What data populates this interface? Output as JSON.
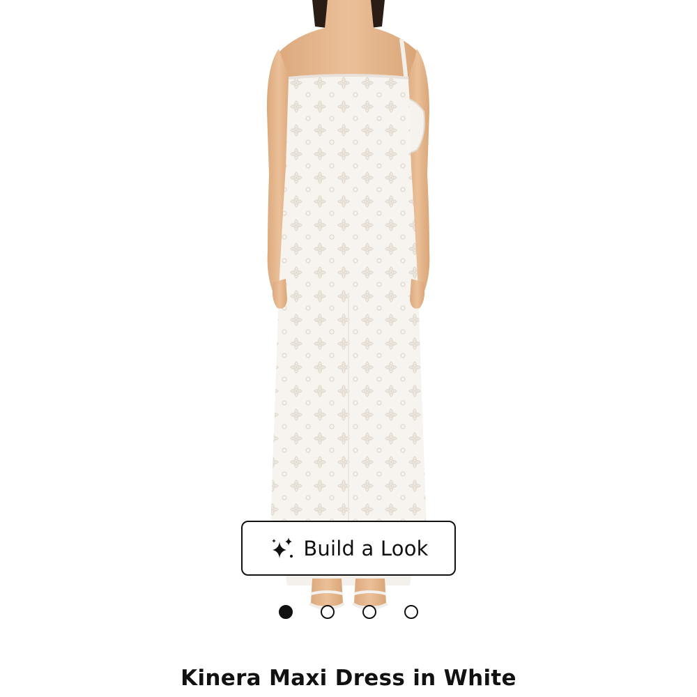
{
  "product": {
    "image_alt": "Model wearing white strapless lace maxi dress with white shoulder bag and white sandals",
    "title": "Kinera Maxi Dress in White"
  },
  "build_look": {
    "label": "Build a Look",
    "icon": "sparkles-icon"
  },
  "carousel": {
    "total": 4,
    "active_index": 0
  },
  "colors": {
    "accent": "#111111",
    "background": "#ffffff",
    "skin": "#e7b98e",
    "dress": "#f6f3ef"
  }
}
